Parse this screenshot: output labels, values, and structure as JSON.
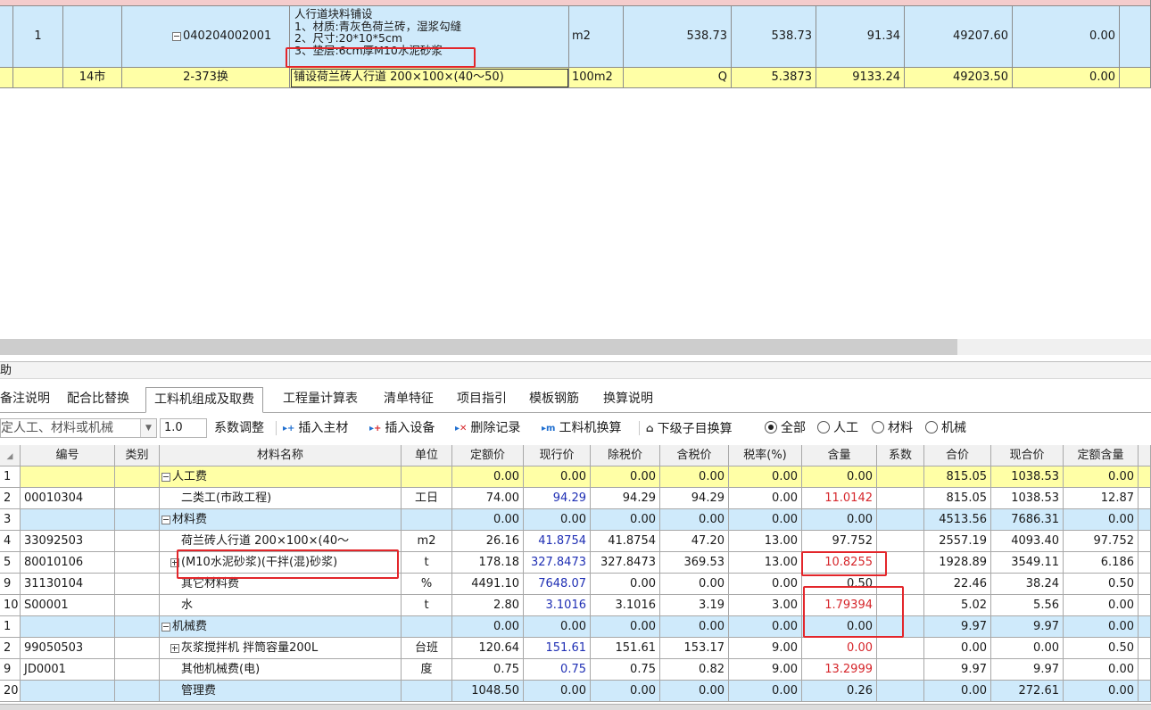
{
  "top_grid": {
    "row1": {
      "seq": "1",
      "code": "040204002001",
      "desc_lines": [
        "人行道块料铺设",
        "1、材质:青灰色荷兰砖，湿浆勾缝",
        "2、尺寸:20*10*5cm",
        "3、垫层:6cm厚M10水泥砂浆"
      ],
      "unit": "m2",
      "qty_expr": "538.73",
      "qty": "538.73",
      "price": "91.34",
      "total": "49207.60",
      "last": "0.00"
    },
    "row2": {
      "type": "14市",
      "code": "2-373换",
      "name": "铺设荷兰砖人行道 200×100×(40～50)",
      "unit": "100m2",
      "qty_expr": "Q",
      "qty": "5.3873",
      "price": "9133.24",
      "total": "49203.50",
      "last": "0.00"
    }
  },
  "panel_title": "助",
  "tabs": [
    "备注说明",
    "配合比替换",
    "工料机组成及取费",
    "工程量计算表",
    "清单特征",
    "项目指引",
    "模板钢筋",
    "换算说明"
  ],
  "active_tab": "工料机组成及取费",
  "toolbar": {
    "combo_text": "定人工、材料或机械",
    "coef_value": "1.0",
    "coef_label": "系数调整",
    "insert_main": "插入主材",
    "insert_equip": "插入设备",
    "delete_record": "删除记录",
    "lmj_convert": "工料机换算",
    "sub_convert": "下级子目换算",
    "filters": [
      "全部",
      "人工",
      "材料",
      "机械"
    ]
  },
  "material_table": {
    "columns": [
      "编号",
      "类别",
      "材料名称",
      "单位",
      "定额价",
      "现行价",
      "除税价",
      "含税价",
      "税率(%)",
      "含量",
      "系数",
      "合价",
      "现合价",
      "定额含量"
    ],
    "rows": [
      {
        "idx": "1",
        "code": "",
        "cat": "",
        "name": "人工费",
        "group": true,
        "unit": "",
        "quota": "0.00",
        "cur": "0.00",
        "notax": "0.00",
        "tax": "0.00",
        "rate": "0.00",
        "qty": "0.00",
        "coef": "",
        "sum": "815.05",
        "cursum": "1038.53",
        "qqty": "0.00",
        "style": "y"
      },
      {
        "idx": "2",
        "code": "00010304",
        "cat": "",
        "name": "二类工(市政工程)",
        "group": false,
        "unit": "工日",
        "quota": "74.00",
        "cur": "94.29",
        "notax": "94.29",
        "tax": "94.29",
        "rate": "0.00",
        "qty": "11.0142",
        "coef": "",
        "sum": "815.05",
        "cursum": "1038.53",
        "qqty": "12.87",
        "style": "w"
      },
      {
        "idx": "3",
        "code": "",
        "cat": "",
        "name": "材料费",
        "group": true,
        "unit": "",
        "quota": "0.00",
        "cur": "0.00",
        "notax": "0.00",
        "tax": "0.00",
        "rate": "0.00",
        "qty": "0.00",
        "coef": "",
        "sum": "4513.56",
        "cursum": "7686.31",
        "qqty": "0.00",
        "style": "b"
      },
      {
        "idx": "4",
        "code": "33092503",
        "cat": "",
        "name": "荷兰砖人行道  200×100×(40～",
        "group": false,
        "unit": "m2",
        "quota": "26.16",
        "cur": "41.8754",
        "notax": "41.8754",
        "tax": "47.20",
        "rate": "13.00",
        "qty": "97.752",
        "coef": "",
        "sum": "2557.19",
        "cursum": "4093.40",
        "qqty": "97.752",
        "style": "w"
      },
      {
        "idx": "5",
        "code": "80010106",
        "cat": "",
        "name": "(M10水泥砂浆)(干拌(混)砂浆)",
        "group": false,
        "expand": true,
        "unit": "t",
        "quota": "178.18",
        "cur": "327.8473",
        "notax": "327.8473",
        "tax": "369.53",
        "rate": "13.00",
        "qty": "10.8255",
        "coef": "",
        "sum": "1928.89",
        "cursum": "3549.11",
        "qqty": "6.186",
        "style": "w"
      },
      {
        "idx": "9",
        "code": "31130104",
        "cat": "",
        "name": "其它材料费",
        "group": false,
        "unit": "%",
        "quota": "4491.10",
        "cur": "7648.07",
        "notax": "0.00",
        "tax": "0.00",
        "rate": "0.00",
        "qty": "0.50",
        "coef": "",
        "sum": "22.46",
        "cursum": "38.24",
        "qqty": "0.50",
        "style": "w"
      },
      {
        "idx": "10",
        "code": "S00001",
        "cat": "",
        "name": "水",
        "group": false,
        "unit": "t",
        "quota": "2.80",
        "cur": "3.1016",
        "notax": "3.1016",
        "tax": "3.19",
        "rate": "3.00",
        "qty": "1.79394",
        "coef": "",
        "sum": "5.02",
        "cursum": "5.56",
        "qqty": "0.00",
        "style": "w"
      },
      {
        "idx": "1",
        "code": "",
        "cat": "",
        "name": "机械费",
        "group": true,
        "unit": "",
        "quota": "0.00",
        "cur": "0.00",
        "notax": "0.00",
        "tax": "0.00",
        "rate": "0.00",
        "qty": "0.00",
        "coef": "",
        "sum": "9.97",
        "cursum": "9.97",
        "qqty": "0.00",
        "style": "b"
      },
      {
        "idx": "2",
        "code": "99050503",
        "cat": "",
        "name": "灰浆搅拌机 拌筒容量200L",
        "group": false,
        "expand": true,
        "unit": "台班",
        "quota": "120.64",
        "cur": "151.61",
        "notax": "151.61",
        "tax": "153.17",
        "rate": "9.00",
        "qty": "0.00",
        "coef": "",
        "sum": "0.00",
        "cursum": "0.00",
        "qqty": "0.50",
        "style": "w"
      },
      {
        "idx": "9",
        "code": "JD0001",
        "cat": "",
        "name": "其他机械费(电)",
        "group": false,
        "unit": "度",
        "quota": "0.75",
        "cur": "0.75",
        "notax": "0.75",
        "tax": "0.82",
        "rate": "9.00",
        "qty": "13.2999",
        "coef": "",
        "sum": "9.97",
        "cursum": "9.97",
        "qqty": "0.00",
        "style": "w"
      },
      {
        "idx": "20",
        "code": "",
        "cat": "",
        "name": "管理费",
        "group": false,
        "unit": "",
        "quota": "1048.50",
        "cur": "0.00",
        "notax": "0.00",
        "tax": "0.00",
        "rate": "0.00",
        "qty": "0.26",
        "coef": "",
        "sum": "0.00",
        "cursum": "272.61",
        "qqty": "0.00",
        "style": "b"
      }
    ]
  },
  "colors": {
    "yellow_row": "#ffffa6",
    "blue_row": "#cfeafb",
    "red_highlight": "#e3262b",
    "blue_text": "#1f2fb4",
    "red_text": "#d6262b"
  }
}
